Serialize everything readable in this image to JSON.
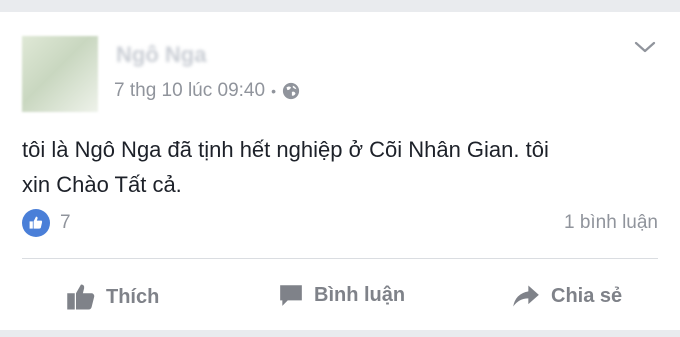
{
  "post": {
    "author_name": "Ngô Nga",
    "timestamp": "7 thg 10 lúc 09:40",
    "separator": "•",
    "privacy_icon": "globe-icon",
    "text_line1": "tôi là Ngô Nga đã tịnh hết nghiệp ở Cõi Nhân Gian. tôi",
    "text_line2": "xin Chào Tất cả."
  },
  "stats": {
    "likes": "7",
    "comments": "1 bình luận"
  },
  "actions": {
    "like_label": "Thích",
    "comment_label": "Bình luận",
    "share_label": "Chia sẻ"
  },
  "colors": {
    "background": "#e9ebee",
    "card": "#ffffff",
    "text": "#1d2129",
    "meta": "#90949c",
    "like_blue": "#4a7fd8",
    "action": "#7f8289"
  }
}
